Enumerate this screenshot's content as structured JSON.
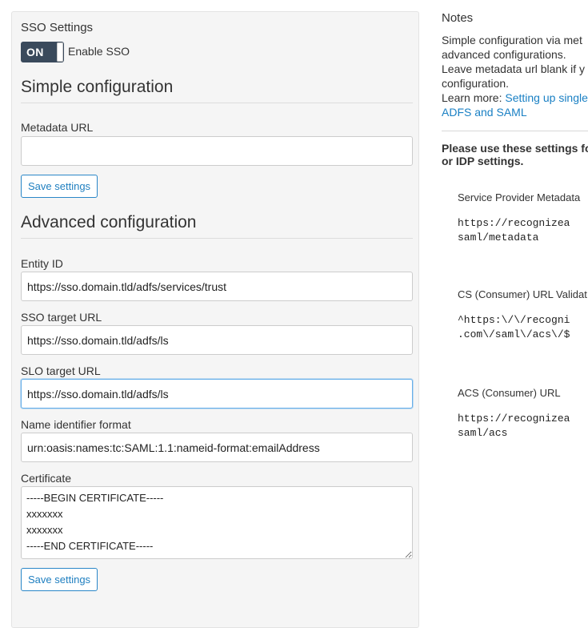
{
  "sso": {
    "section_title": "SSO Settings",
    "toggle_state": "ON",
    "toggle_label": "Enable SSO"
  },
  "simple": {
    "heading": "Simple configuration",
    "metadata_url_label": "Metadata URL",
    "metadata_url_value": "",
    "save_label": "Save settings"
  },
  "advanced": {
    "heading": "Advanced configuration",
    "entity_id_label": "Entity ID",
    "entity_id_value": "https://sso.domain.tld/adfs/services/trust",
    "sso_target_label": "SSO target URL",
    "sso_target_value": "https://sso.domain.tld/adfs/ls",
    "slo_target_label": "SLO target URL",
    "slo_target_value": "https://sso.domain.tld/adfs/ls",
    "name_id_label": "Name identifier format",
    "name_id_value": "urn:oasis:names:tc:SAML:1.1:nameid-format:emailAddress",
    "certificate_label": "Certificate",
    "certificate_value": "-----BEGIN CERTIFICATE-----\nxxxxxxx\nxxxxxxx\n-----END CERTIFICATE-----",
    "save_label": "Save settings"
  },
  "notes": {
    "title": "Notes",
    "line1": "Simple configuration via met",
    "line2": "advanced configurations.",
    "line3": "Leave metadata url blank if y",
    "line4": "configuration.",
    "learn_more": "Learn more:",
    "link_line1": "Setting up single",
    "link_line2": "ADFS and SAML",
    "bold_line1": "Please use these settings fo",
    "bold_line2": "or IDP settings.",
    "sp_metadata_label": "Service Provider Metadata",
    "sp_metadata_line1": "https://recognizea",
    "sp_metadata_line2": "saml/metadata",
    "cs_url_label": "CS (Consumer) URL Validat",
    "cs_url_line1": "^https:\\/\\/recogni",
    "cs_url_line2": ".com\\/saml\\/acs\\/$",
    "acs_label": "ACS (Consumer) URL",
    "acs_line1": "https://recognizea",
    "acs_line2": "saml/acs"
  },
  "colors": {
    "toggle_bg": "#3a4a5c",
    "link": "#1a80c4",
    "button_border": "#2a87c8",
    "focus_border": "#66afe9"
  }
}
